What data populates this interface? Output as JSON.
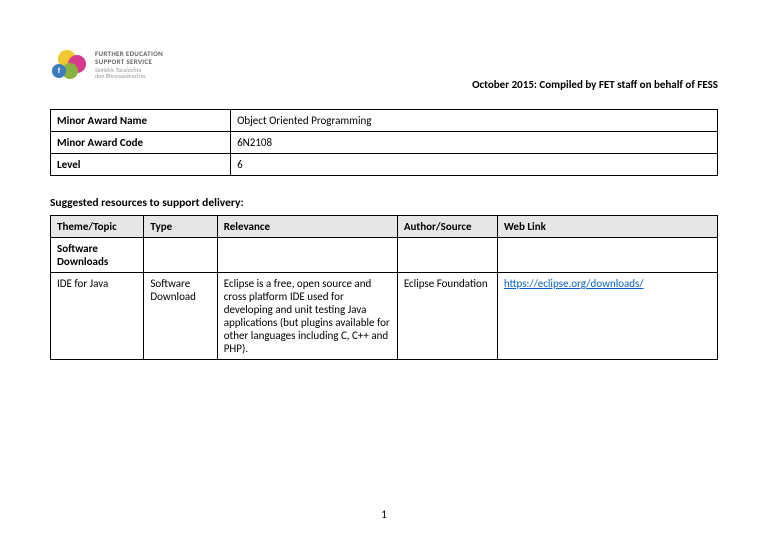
{
  "header": {
    "logo": {
      "line1": "FURTHER EDUCATION",
      "line2": "SUPPORT SERVICE",
      "line3": "Seirbhís Tacaíochta",
      "line4": "don Bhreisoideachas"
    },
    "right": "October 2015: Compiled by FET staff on behalf of FESS"
  },
  "info": {
    "rows": [
      {
        "label": "Minor Award Name",
        "value": "Object Oriented Programming"
      },
      {
        "label": "Minor Award Code",
        "value": "6N2108"
      },
      {
        "label": "Level",
        "value": "6"
      }
    ]
  },
  "section_title": "Suggested resources to support delivery:",
  "resources": {
    "headers": {
      "theme": "Theme/Topic",
      "type": "Type",
      "relevance": "Relevance",
      "author": "Author/Source",
      "link": "Web Link"
    },
    "section_label": "Software Downloads",
    "rows": [
      {
        "theme": "IDE for Java",
        "type": "Software Download",
        "relevance": "Eclipse is a free, open source and cross platform IDE used for developing and unit testing Java applications (but plugins available for other languages including C, C++ and PHP).",
        "author": "Eclipse Foundation",
        "link": "https://eclipse.org/downloads/"
      }
    ]
  },
  "page_number": "1"
}
